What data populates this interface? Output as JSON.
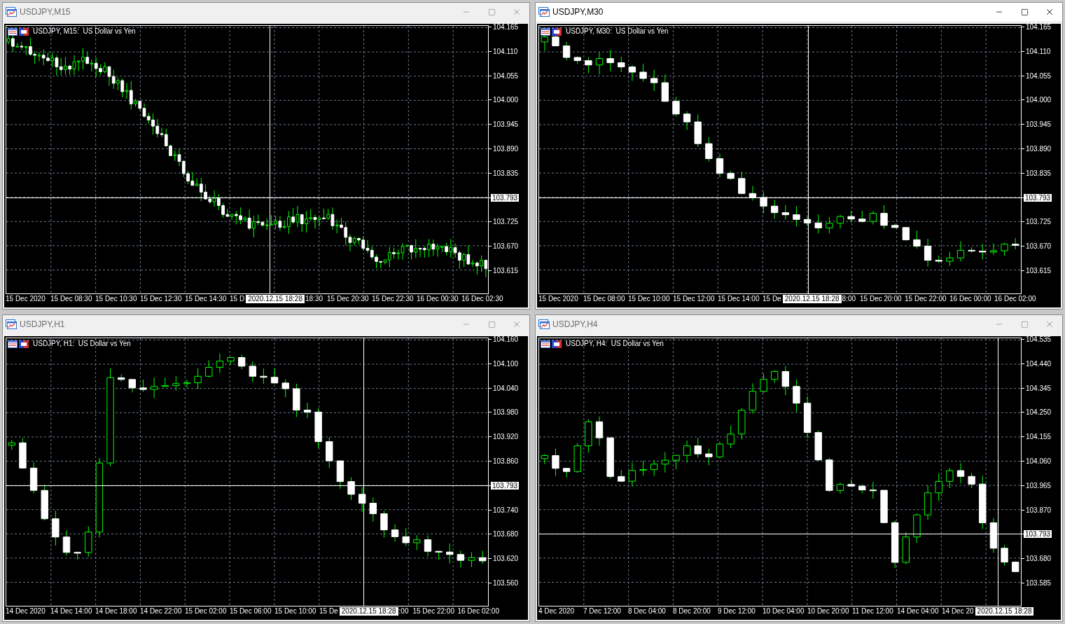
{
  "windows": [
    {
      "title": "USDJPY,M15",
      "active": false,
      "legend": "USDJPY, M15:  US Dollar vs Yen",
      "price_axis": [
        {
          "kind": "label",
          "text": "104.165"
        },
        {
          "kind": "label",
          "text": "104.110"
        },
        {
          "kind": "label",
          "text": "104.055"
        },
        {
          "kind": "label",
          "text": "104.000"
        },
        {
          "kind": "label",
          "text": "103.945"
        },
        {
          "kind": "label",
          "text": "103.890"
        },
        {
          "kind": "label",
          "text": "103.835"
        },
        {
          "kind": "current",
          "text": "103.793"
        },
        {
          "kind": "label",
          "text": "103.725"
        },
        {
          "kind": "label",
          "text": "103.670"
        },
        {
          "kind": "label",
          "text": "103.615"
        }
      ],
      "time_axis": [
        {
          "kind": "label",
          "text": "15 Dec 2020"
        },
        {
          "kind": "label",
          "text": "15 Dec 08:30"
        },
        {
          "kind": "label",
          "text": "15 Dec 10:30"
        },
        {
          "kind": "label",
          "text": "15 Dec 12:30"
        },
        {
          "kind": "label",
          "text": "15 Dec 14:30"
        },
        {
          "kind": "label",
          "text": "15 D"
        },
        {
          "kind": "crosshair",
          "text": "2020.12.15 18:28"
        },
        {
          "kind": "label",
          "text": "18:30"
        },
        {
          "kind": "label",
          "text": "15 Dec 20:30"
        },
        {
          "kind": "label",
          "text": "15 Dec 22:30"
        },
        {
          "kind": "label",
          "text": "16 Dec 00:30"
        },
        {
          "kind": "label",
          "text": "16 Dec 02:30"
        }
      ]
    },
    {
      "title": "USDJPY,M30",
      "active": true,
      "legend": "USDJPY, M30:  US Dollar vs Yen",
      "price_axis": [
        {
          "kind": "label",
          "text": "104.165"
        },
        {
          "kind": "label",
          "text": "104.110"
        },
        {
          "kind": "label",
          "text": "104.055"
        },
        {
          "kind": "label",
          "text": "104.000"
        },
        {
          "kind": "label",
          "text": "103.945"
        },
        {
          "kind": "label",
          "text": "103.890"
        },
        {
          "kind": "label",
          "text": "103.835"
        },
        {
          "kind": "current",
          "text": "103.793"
        },
        {
          "kind": "label",
          "text": "103.725"
        },
        {
          "kind": "label",
          "text": "103.670"
        },
        {
          "kind": "label",
          "text": "103.615"
        }
      ],
      "time_axis": [
        {
          "kind": "label",
          "text": "15 Dec 2020"
        },
        {
          "kind": "label",
          "text": "15 Dec 08:00"
        },
        {
          "kind": "label",
          "text": "15 Dec 10:00"
        },
        {
          "kind": "label",
          "text": "15 Dec 12:00"
        },
        {
          "kind": "label",
          "text": "15 Dec 14:00"
        },
        {
          "kind": "label",
          "text": "15 De"
        },
        {
          "kind": "crosshair",
          "text": "2020.12.15 18:28"
        },
        {
          "kind": "label",
          "text": "8:00"
        },
        {
          "kind": "label",
          "text": "15 Dec 20:00"
        },
        {
          "kind": "label",
          "text": "15 Dec 22:00"
        },
        {
          "kind": "label",
          "text": "16 Dec 00:00"
        },
        {
          "kind": "label",
          "text": "16 Dec 02:00"
        }
      ]
    },
    {
      "title": "USDJPY,H1",
      "active": false,
      "legend": "USDJPY, H1:  US Dollar vs Yen",
      "price_axis": [
        {
          "kind": "label",
          "text": "104.160"
        },
        {
          "kind": "label",
          "text": "104.100"
        },
        {
          "kind": "label",
          "text": "104.040"
        },
        {
          "kind": "label",
          "text": "103.980"
        },
        {
          "kind": "label",
          "text": "103.920"
        },
        {
          "kind": "label",
          "text": "103.860"
        },
        {
          "kind": "current",
          "text": "103.793"
        },
        {
          "kind": "label",
          "text": "103.740"
        },
        {
          "kind": "label",
          "text": "103.680"
        },
        {
          "kind": "label",
          "text": "103.620"
        },
        {
          "kind": "label",
          "text": "103.560"
        }
      ],
      "time_axis": [
        {
          "kind": "label",
          "text": "14 Dec 2020"
        },
        {
          "kind": "label",
          "text": "14 Dec 14:00"
        },
        {
          "kind": "label",
          "text": "14 Dec 18:00"
        },
        {
          "kind": "label",
          "text": "14 Dec 22:00"
        },
        {
          "kind": "label",
          "text": "15 Dec 02:00"
        },
        {
          "kind": "label",
          "text": "15 Dec 06:00"
        },
        {
          "kind": "label",
          "text": "15 Dec 10:00"
        },
        {
          "kind": "label",
          "text": "15 De"
        },
        {
          "kind": "crosshair",
          "text": "2020.12.15 18:28"
        },
        {
          "kind": "label",
          "text": ":00"
        },
        {
          "kind": "label",
          "text": "15 Dec 22:00"
        },
        {
          "kind": "label",
          "text": "16 Dec 02:00"
        }
      ]
    },
    {
      "title": "USDJPY,H4",
      "active": false,
      "legend": "USDJPY, H4:  US Dollar vs Yen",
      "price_axis": [
        {
          "kind": "label",
          "text": "104.535"
        },
        {
          "kind": "label",
          "text": "104.440"
        },
        {
          "kind": "label",
          "text": "104.345"
        },
        {
          "kind": "label",
          "text": "104.250"
        },
        {
          "kind": "label",
          "text": "104.155"
        },
        {
          "kind": "label",
          "text": "104.060"
        },
        {
          "kind": "label",
          "text": "103.965"
        },
        {
          "kind": "label",
          "text": "103.870"
        },
        {
          "kind": "current",
          "text": "103.793"
        },
        {
          "kind": "label",
          "text": "103.680"
        },
        {
          "kind": "label",
          "text": "103.585"
        }
      ],
      "time_axis": [
        {
          "kind": "label",
          "text": "4 Dec 2020"
        },
        {
          "kind": "label",
          "text": "7 Dec 12:00"
        },
        {
          "kind": "label",
          "text": "8 Dec 04:00"
        },
        {
          "kind": "label",
          "text": "8 Dec 20:00"
        },
        {
          "kind": "label",
          "text": "9 Dec 12:00"
        },
        {
          "kind": "label",
          "text": "10 Dec 04:00"
        },
        {
          "kind": "label",
          "text": "10 Dec 20:00"
        },
        {
          "kind": "label",
          "text": "11 Dec 12:00"
        },
        {
          "kind": "label",
          "text": "14 Dec 04:00"
        },
        {
          "kind": "label",
          "text": "14 Dec 20"
        },
        {
          "kind": "crosshair",
          "text": "2020.12.15 18:28"
        }
      ]
    }
  ]
}
